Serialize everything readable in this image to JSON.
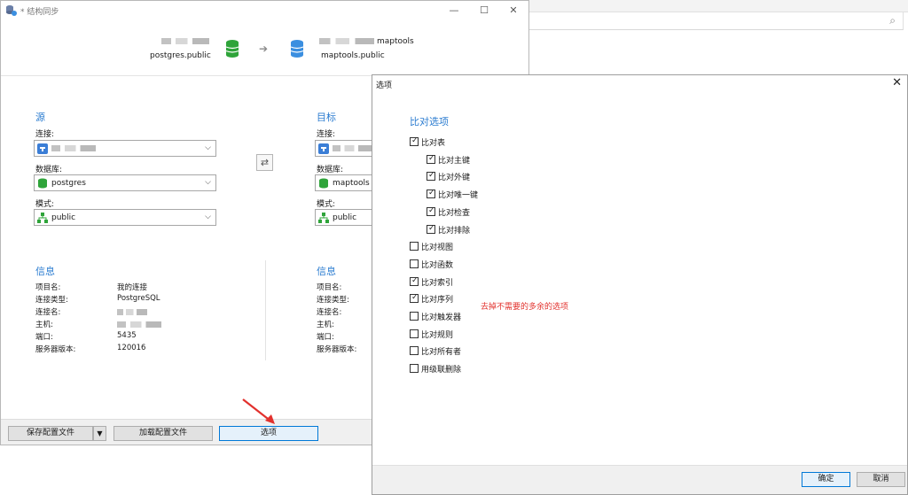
{
  "main_window": {
    "title": "* 结构同步",
    "controls": {
      "minimize": "—",
      "maximize": "☐",
      "close": "✕"
    },
    "source_schema": "postgres.public",
    "target_db_name": "maptools",
    "target_schema": "maptools.public"
  },
  "source": {
    "section_title": "源",
    "connection_label": "连接:",
    "database_label": "数据库:",
    "database_value": "postgres",
    "schema_label": "模式:",
    "schema_value": "public"
  },
  "target": {
    "section_title": "目标",
    "connection_label": "连接:",
    "database_label": "数据库:",
    "database_value": "maptools",
    "schema_label": "模式:",
    "schema_value": "public"
  },
  "info_left": {
    "title": "信息",
    "rows": [
      {
        "key": "项目名:",
        "value": "我的连接"
      },
      {
        "key": "连接类型:",
        "value": "PostgreSQL"
      },
      {
        "key": "连接名:",
        "value": ""
      },
      {
        "key": "主机:",
        "value": ""
      },
      {
        "key": "端口:",
        "value": "5435"
      },
      {
        "key": "服务器版本:",
        "value": "120016"
      }
    ]
  },
  "info_right": {
    "title": "信息",
    "rows": [
      {
        "key": "项目名:"
      },
      {
        "key": "连接类型:"
      },
      {
        "key": "连接名:"
      },
      {
        "key": "主机:"
      },
      {
        "key": "端口:"
      },
      {
        "key": "服务器版本:"
      }
    ]
  },
  "footer": {
    "save_profile": "保存配置文件",
    "load_profile": "加载配置文件",
    "options": "选项"
  },
  "dialog": {
    "title": "选项",
    "close": "✕",
    "group_title": "比对选项",
    "options": [
      {
        "label": "比对表",
        "checked": true
      },
      {
        "label": "比对主键",
        "checked": true
      },
      {
        "label": "比对外键",
        "checked": true
      },
      {
        "label": "比对唯一键",
        "checked": true
      },
      {
        "label": "比对检查",
        "checked": true
      },
      {
        "label": "比对排除",
        "checked": true
      },
      {
        "label": "比对视图",
        "checked": false
      },
      {
        "label": "比对函数",
        "checked": false
      },
      {
        "label": "比对索引",
        "checked": true
      },
      {
        "label": "比对序列",
        "checked": true
      },
      {
        "label": "比对触发器",
        "checked": false
      },
      {
        "label": "比对规则",
        "checked": false
      },
      {
        "label": "比对所有者",
        "checked": false
      },
      {
        "label": "用级联删除",
        "checked": false
      }
    ],
    "annotation": "去掉不需要的多余的选项",
    "ok": "确定",
    "cancel": "取消"
  },
  "colors": {
    "accent": "#2b7cd0",
    "db_source": "#2fa43a",
    "db_target": "#3b8fe0",
    "annotation": "#e2312d"
  }
}
